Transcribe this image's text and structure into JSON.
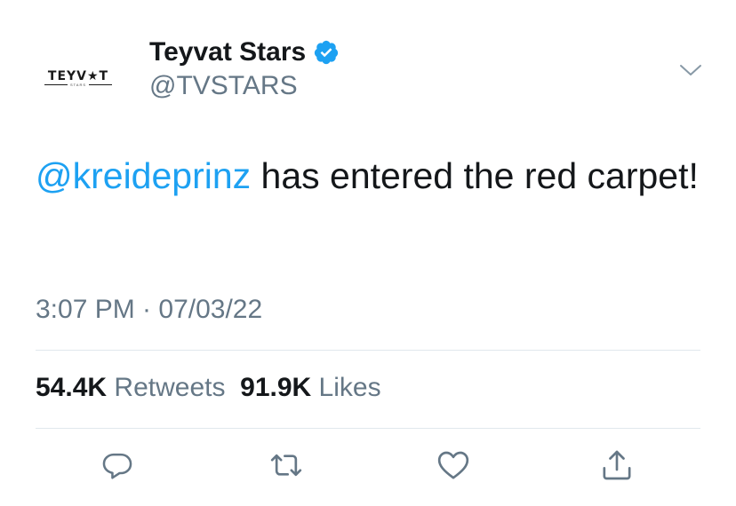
{
  "tweet": {
    "avatar": {
      "logo_text": "TEYV★T",
      "logo_sub": "STARS"
    },
    "display_name": "Teyvat Stars",
    "handle": "@TVSTARS",
    "verified": true,
    "text_mention": "@kreideprinz",
    "text_body": " has entered the red carpet!",
    "timestamp": "3:07 PM · 07/03/22",
    "retweets_count": "54.4K",
    "retweets_label": "Retweets",
    "likes_count": "91.9K",
    "likes_label": "Likes"
  },
  "colors": {
    "accent": "#1da1f2",
    "secondary_text": "#657786",
    "primary_text": "#14171a",
    "divider": "#e1e8ed"
  },
  "icons": {
    "verified": "verified-badge-icon",
    "caret": "chevron-down-icon",
    "reply": "reply-icon",
    "retweet": "retweet-icon",
    "like": "heart-icon",
    "share": "share-icon"
  }
}
